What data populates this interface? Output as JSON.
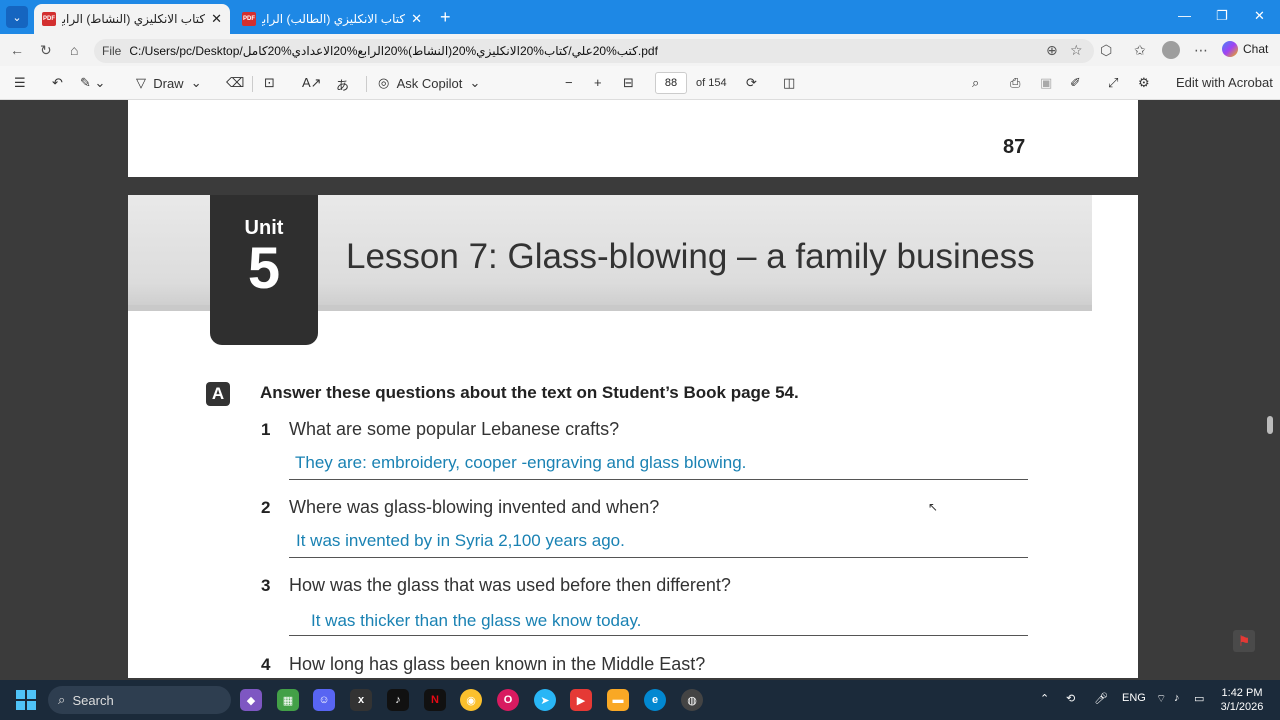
{
  "browser": {
    "tabs": [
      {
        "title": "كتاب الانكليزي (النشاط) الرابع الاعدادي",
        "active": true
      },
      {
        "title": "كتاب الانكليزي (الطالب) الرابع الاعدادي",
        "active": false
      }
    ],
    "url_scheme": "File",
    "url": "C:/Users/pc/Desktop/كتب%20علي/كتاب%20الانكليزي%20(النشاط)%20الرابع%20الاعدادي%20كامل.pdf",
    "chat_label": "Chat"
  },
  "pdf_toolbar": {
    "draw_label": "Draw",
    "copilot_label": "Ask Copilot",
    "page_current": "88",
    "page_total": "of 154",
    "edit_label": "Edit with Acrobat"
  },
  "document": {
    "prev_page_number": "87",
    "unit_label": "Unit",
    "unit_number": "5",
    "lesson_title": "Lesson 7: Glass-blowing – a family business",
    "section_label": "A",
    "instruction": "Answer these questions about the text on Student’s Book page 54.",
    "questions": [
      {
        "num": "1",
        "text": "What are some popular Lebanese crafts?",
        "answer": "They are: embroidery, cooper -engraving and glass blowing."
      },
      {
        "num": "2",
        "text": "Where was glass-blowing invented and when?",
        "answer": "It was invented by in Syria 2,100 years ago."
      },
      {
        "num": "3",
        "text": "How was the glass that was used before then different?",
        "answer": "It was thicker than the glass we know today."
      },
      {
        "num": "4",
        "text": "How long has glass been known in the Middle East?",
        "answer": ""
      }
    ]
  },
  "taskbar": {
    "search_placeholder": "Search",
    "language": "ENG",
    "time": "1:42 PM",
    "date": "3/1/2026"
  },
  "colors": {
    "tab_bar": "#1e88e5",
    "answer_text": "#1a82b3",
    "pdf_icon": "#d32f2f"
  }
}
